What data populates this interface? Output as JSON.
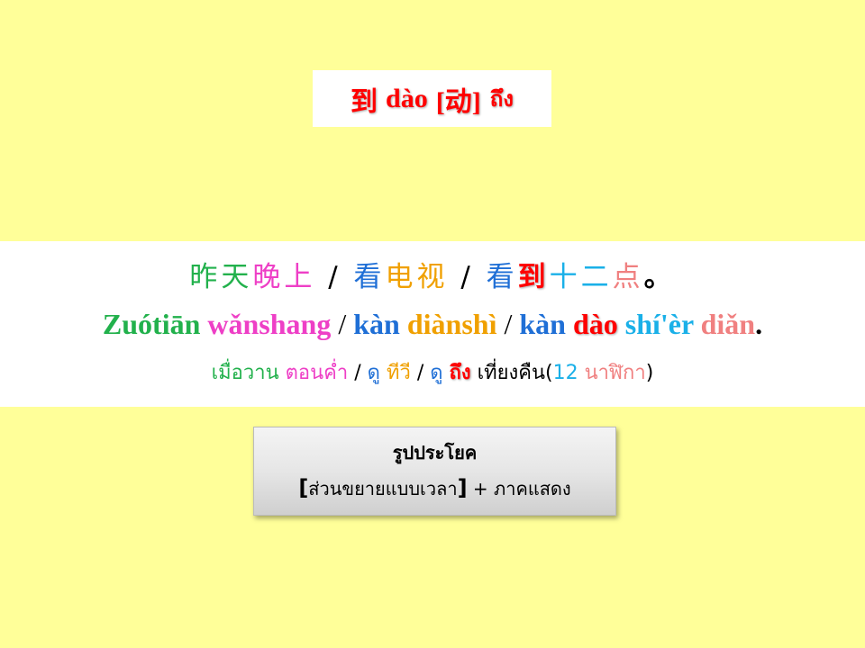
{
  "title": {
    "hanzi": "到",
    "pinyin": "dào",
    "pos": "[动]",
    "thai": "ถึง"
  },
  "sentence": {
    "hanzi": [
      {
        "text": "昨天",
        "color": "#22b14c"
      },
      {
        "text": "晚上",
        "color": "#ee3fc6"
      },
      {
        "text": "/",
        "color": "#000000"
      },
      {
        "text": "看",
        "color": "#1f6fd6"
      },
      {
        "text": "电视",
        "color": "#f0a000"
      },
      {
        "text": "/",
        "color": "#000000"
      },
      {
        "text": "看",
        "color": "#1f6fd6"
      },
      {
        "text": "到",
        "color": "#ff0000"
      },
      {
        "text": "十二",
        "color": "#1ab0e8"
      },
      {
        "text": "点",
        "color": "#f08080"
      },
      {
        "text": "。",
        "color": "#000000"
      }
    ],
    "pinyin": [
      {
        "text": "Zuótiān",
        "color": "#22b14c"
      },
      {
        "text": "wǎnshang",
        "color": "#ee3fc6"
      },
      {
        "text": "/",
        "color": "#000000"
      },
      {
        "text": "kàn",
        "color": "#1f6fd6"
      },
      {
        "text": "diànshì",
        "color": "#f0a000"
      },
      {
        "text": "/",
        "color": "#000000"
      },
      {
        "text": "kàn",
        "color": "#1f6fd6"
      },
      {
        "text": "dào",
        "color": "#ff0000"
      },
      {
        "text": "shí'èr",
        "color": "#1ab0e8"
      },
      {
        "text": "diǎn",
        "color": "#f08080"
      },
      {
        "text": ".",
        "color": "#000000"
      }
    ],
    "thai": [
      {
        "text": "เมื่อวาน",
        "color": "#22b14c"
      },
      {
        "text": "ตอนค่ำ",
        "color": "#ee3fc6"
      },
      {
        "text": "/",
        "color": "#000000"
      },
      {
        "text": "ดู",
        "color": "#1f6fd6"
      },
      {
        "text": "ทีวี",
        "color": "#f0a000"
      },
      {
        "text": "/",
        "color": "#000000"
      },
      {
        "text": "ดู",
        "color": "#1f6fd6"
      },
      {
        "text": "ถึง",
        "color": "#ff0000"
      },
      {
        "text": "เที่ยงคืน",
        "color": "#000000"
      },
      {
        "text": "(",
        "color": "#000000"
      },
      {
        "text": "12",
        "color": "#1ab0e8"
      },
      {
        "text": "นาฬิกา",
        "color": "#f08080"
      },
      {
        "text": ")",
        "color": "#000000"
      }
    ]
  },
  "pattern": {
    "title": "รูปประโยค",
    "open_bracket": "[",
    "adverbial": "ส่วนขยายแบบเวลา",
    "close_bracket": "]",
    "plus": "+",
    "predicate": "ภาคแสดง"
  }
}
